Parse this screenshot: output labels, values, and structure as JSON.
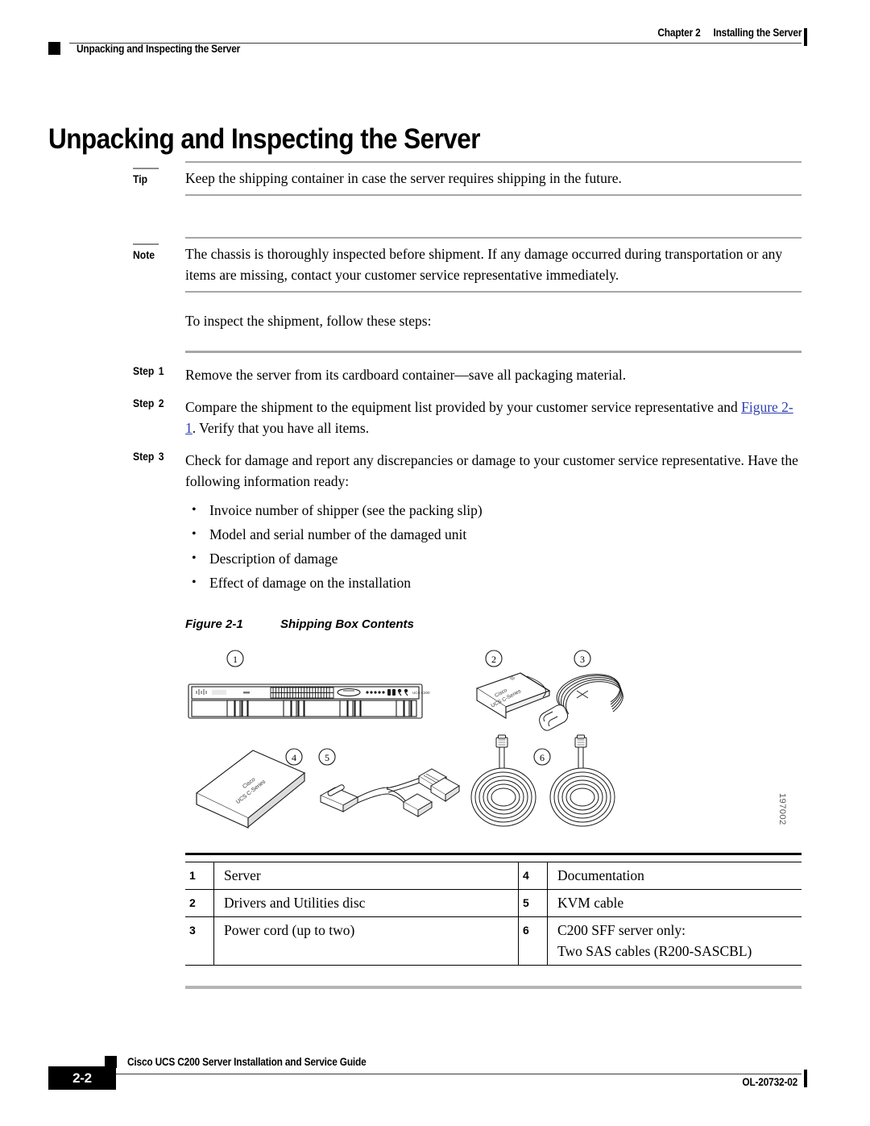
{
  "header": {
    "chapter": "Chapter 2",
    "chapter_title": "Installing the Server",
    "section": "Unpacking and Inspecting the Server"
  },
  "title": "Unpacking and Inspecting the Server",
  "tip": {
    "label": "Tip",
    "body": "Keep the shipping container in case the server requires shipping in the future."
  },
  "note": {
    "label": "Note",
    "body": "The chassis is thoroughly inspected before shipment. If any damage occurred during transportation or any items are missing, contact your customer service representative immediately."
  },
  "intro": "To inspect the shipment, follow these steps:",
  "steps": [
    {
      "label": "Step",
      "number": "1",
      "text": "Remove the server from its cardboard container—save all packaging material.",
      "link": "",
      "text_after": ""
    },
    {
      "label": "Step",
      "number": "2",
      "text": "Compare the shipment to the equipment list provided by your customer service representative and ",
      "link": "Figure 2-1",
      "text_after": ". Verify that you have all items."
    },
    {
      "label": "Step",
      "number": "3",
      "text": "Check for damage and report any discrepancies or damage to your customer service representative. Have the following information ready:",
      "link": "",
      "text_after": ""
    }
  ],
  "bullets": [
    "Invoice number of shipper (see the packing slip)",
    "Model and serial number of the damaged unit",
    "Description of damage",
    "Effect of damage on the installation"
  ],
  "figure": {
    "number": "Figure 2-1",
    "caption": "Shipping Box Contents",
    "art_id": "197002",
    "callouts": [
      "1",
      "2",
      "3",
      "4",
      "5",
      "6"
    ],
    "server_panel_label": "UCS C200",
    "disc_label_line1": "Cisco",
    "disc_label_line2": "UCS C-Series",
    "book_label_line1": "Cisco",
    "book_label_line2": "UCS C-Series"
  },
  "legend": [
    {
      "left_num": "1",
      "left_text": "Server",
      "right_num": "4",
      "right_text": "Documentation"
    },
    {
      "left_num": "2",
      "left_text": "Drivers and Utilities disc",
      "right_num": "5",
      "right_text": "KVM cable"
    },
    {
      "left_num": "3",
      "left_text": "Power cord (up to two)",
      "right_num": "6",
      "right_text": "C200 SFF server only:",
      "right_text2": "Two SAS cables (R200-SASCBL)"
    }
  ],
  "footer": {
    "page_number": "2-2",
    "guide_title": "Cisco UCS C200 Server Installation and Service Guide",
    "doc_id": "OL-20732-02"
  }
}
